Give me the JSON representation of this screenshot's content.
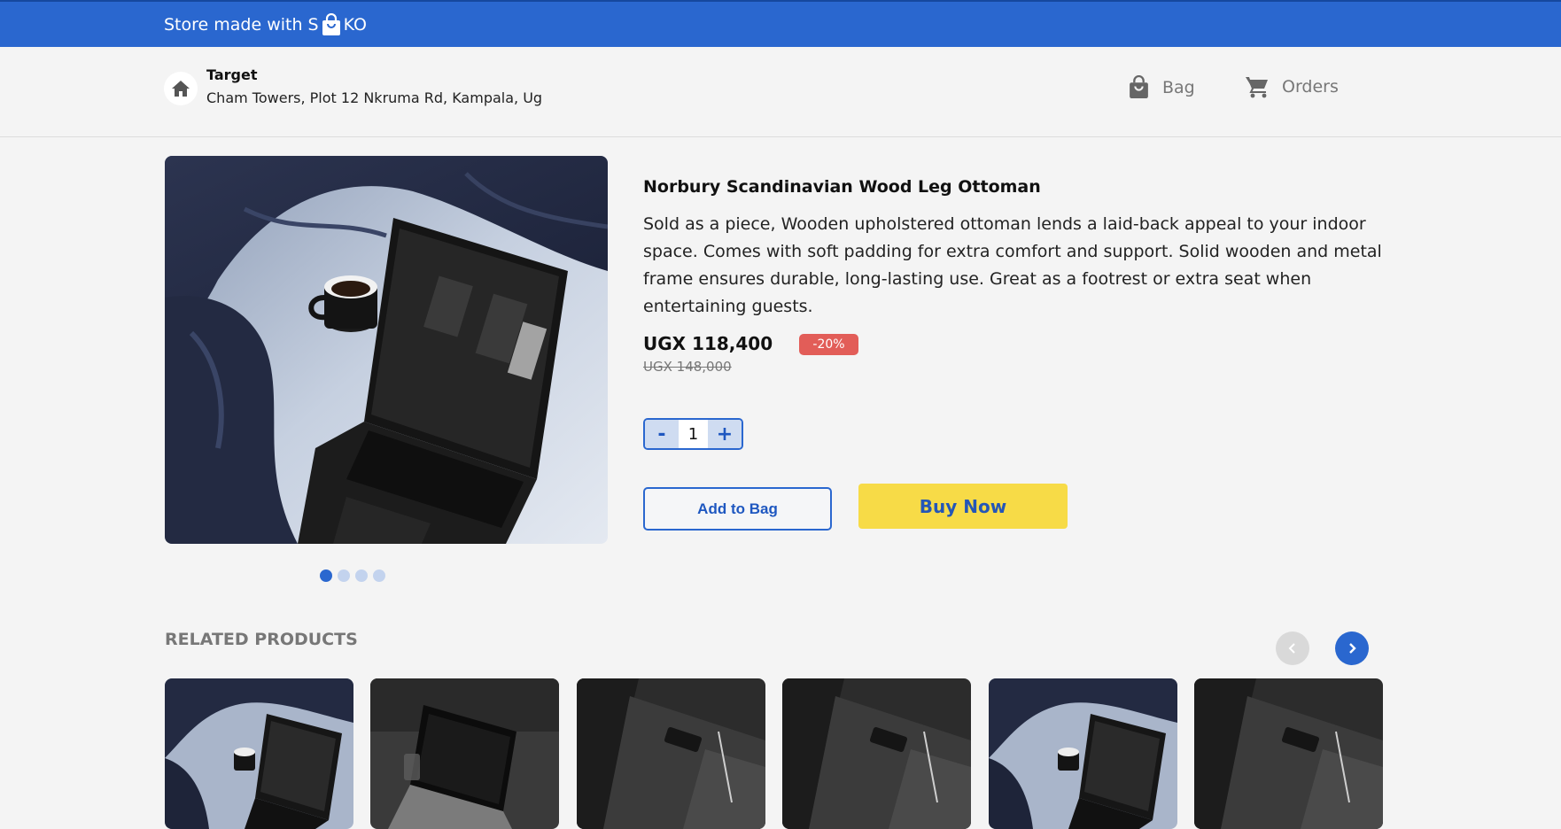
{
  "topbar": {
    "prefix": "Store made with S",
    "suffix": "KO"
  },
  "store": {
    "name": "Target",
    "address": "Cham Towers, Plot 12 Nkruma Rd, Kampala, Ug"
  },
  "nav": {
    "bag": "Bag",
    "orders": "Orders"
  },
  "product": {
    "title": "Norbury Scandinavian Wood Leg Ottoman",
    "description": "Sold as a piece, Wooden upholstered ottoman lends a laid-back appeal to your indoor space. Comes with soft padding for extra comfort and support. Solid wooden and metal frame ensures durable, long-lasting use. Great as a footrest or extra seat when entertaining guests.",
    "price": "UGX 118,400",
    "old_price": "UGX 148,000",
    "discount": "-20%",
    "quantity": "1",
    "decrement": "-",
    "increment": "+",
    "add_to_bag": "Add to Bag",
    "buy_now": "Buy Now"
  },
  "related": {
    "title": "RELATED PRODUCTS"
  },
  "colors": {
    "brand": "#2a67cf",
    "buy": "#f7db47",
    "discount": "#e25d58"
  }
}
